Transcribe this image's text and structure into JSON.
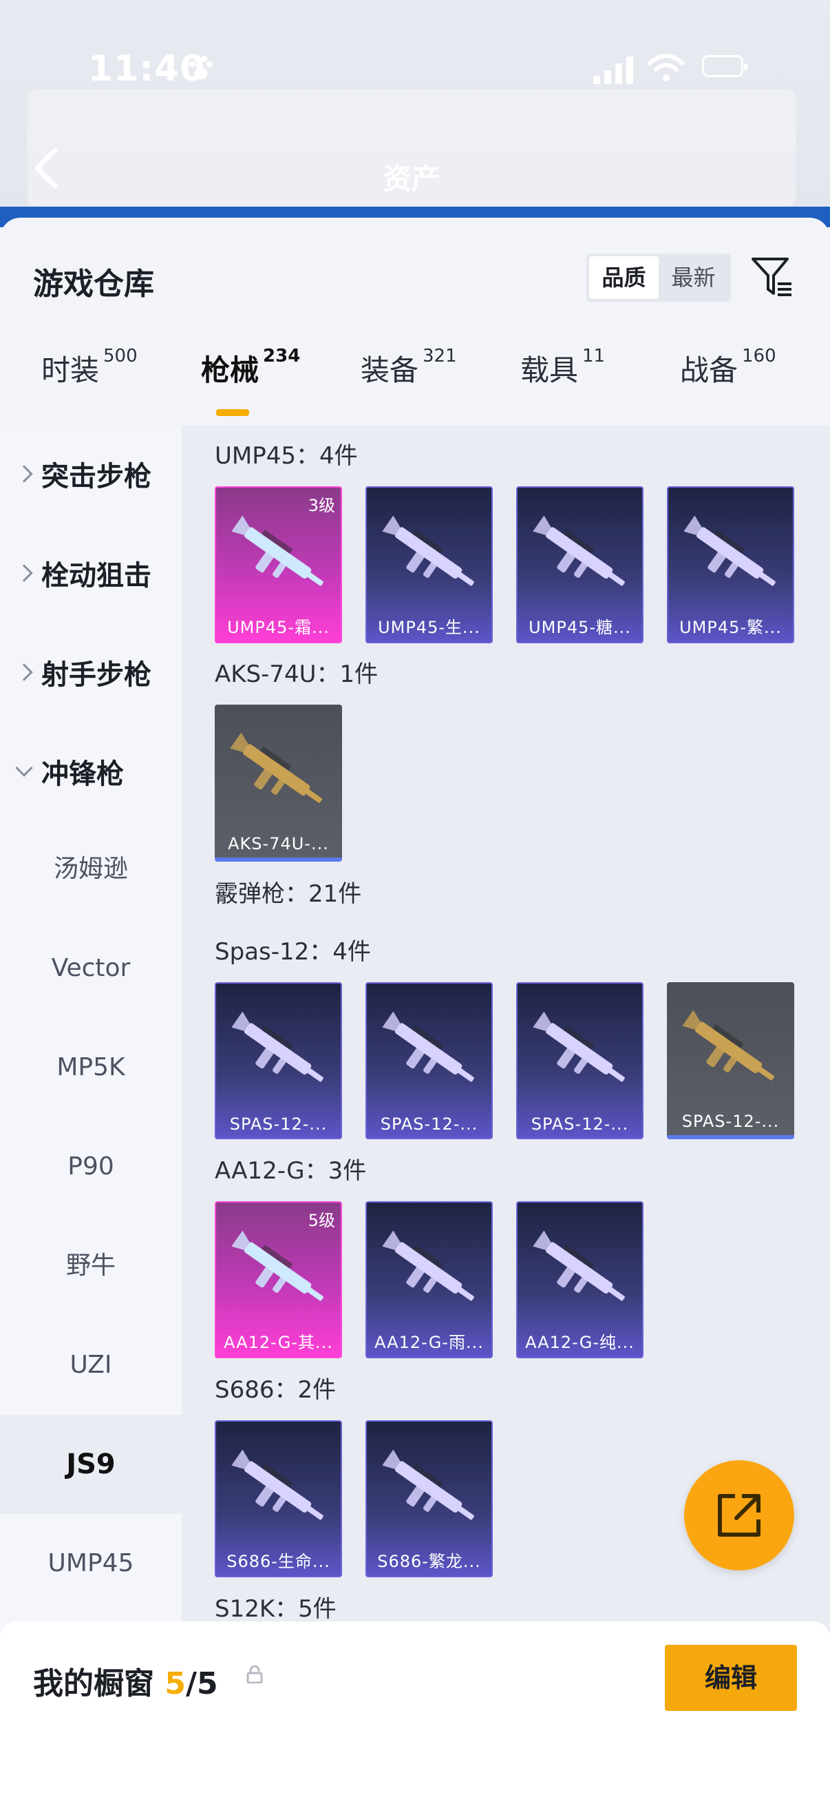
{
  "status_bar": {
    "time": "11:40"
  },
  "header": {
    "title": "资产"
  },
  "sheet": {
    "title": "游戏仓库",
    "sort_options": [
      "品质",
      "最新"
    ],
    "active_sort": "品质"
  },
  "tabs": [
    {
      "label": "时装",
      "count": "500"
    },
    {
      "label": "枪械",
      "count": "234"
    },
    {
      "label": "装备",
      "count": "321"
    },
    {
      "label": "载具",
      "count": "11"
    },
    {
      "label": "战备",
      "count": "160"
    }
  ],
  "active_tab": "枪械",
  "sidebar": {
    "categories": [
      "突击步枪",
      "栓动狙击",
      "射手步枪",
      "冲锋枪"
    ],
    "subitems": [
      "汤姆逊",
      "Vector",
      "MP5K",
      "P90",
      "野牛",
      "UZI",
      "JS9",
      "UMP45"
    ],
    "selected_sub": "JS9"
  },
  "groups": [
    {
      "title": "UMP45：4件",
      "items": [
        {
          "name": "UMP45-霜...",
          "rarity": "pink",
          "level": "3级"
        },
        {
          "name": "UMP45-生...",
          "rarity": "blue"
        },
        {
          "name": "UMP45-糖...",
          "rarity": "blue"
        },
        {
          "name": "UMP45-繁...",
          "rarity": "blue"
        }
      ]
    },
    {
      "title": "AKS-74U：1件",
      "items": [
        {
          "name": "AKS-74U-...",
          "rarity": "gray"
        }
      ]
    },
    {
      "title": "霰弹枪：21件",
      "items": []
    },
    {
      "title": "Spas-12：4件",
      "items": [
        {
          "name": "SPAS-12-...",
          "rarity": "blue"
        },
        {
          "name": "SPAS-12-...",
          "rarity": "blue"
        },
        {
          "name": "SPAS-12-...",
          "rarity": "blue"
        },
        {
          "name": "SPAS-12-...",
          "rarity": "gray"
        }
      ]
    },
    {
      "title": "AA12-G：3件",
      "items": [
        {
          "name": "AA12-G-其...",
          "rarity": "pink",
          "level": "5级"
        },
        {
          "name": "AA12-G-雨...",
          "rarity": "blue"
        },
        {
          "name": "AA12-G-纯...",
          "rarity": "blue"
        }
      ]
    },
    {
      "title": "S686：2件",
      "items": [
        {
          "name": "S686-生命...",
          "rarity": "blue"
        },
        {
          "name": "S686-繁龙...",
          "rarity": "blue"
        }
      ]
    },
    {
      "title": "S12K：5件",
      "items": []
    }
  ],
  "showcase": {
    "label": "我的橱窗",
    "current": "5",
    "total": "/5"
  },
  "edit_button": "编辑",
  "colors": {
    "accent": "#f5ad00",
    "pink_rarity": "#ff49d8",
    "blue_rarity": "#6a63d8"
  }
}
